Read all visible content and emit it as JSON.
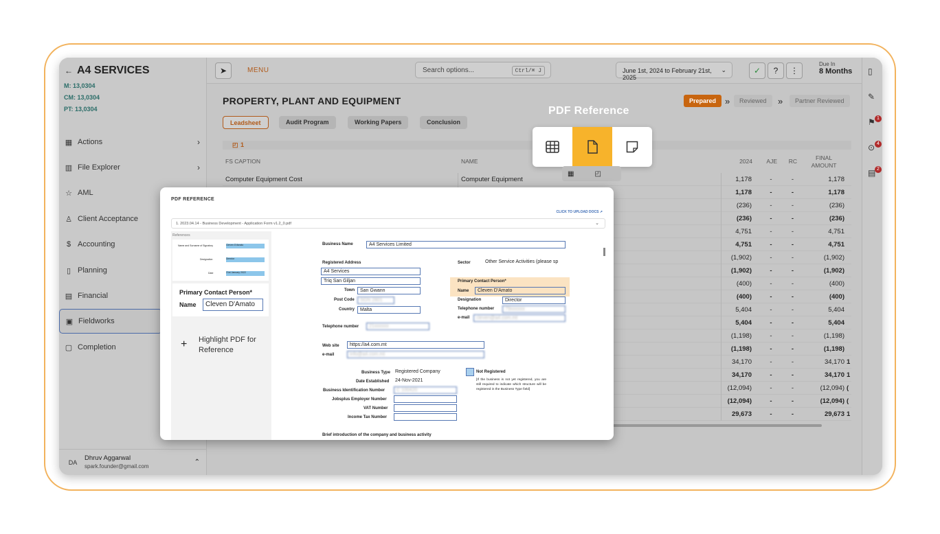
{
  "sidebar": {
    "company": "A4 SERVICES",
    "metrics": [
      "M: 13,0304",
      "CM: 13,0304",
      "PT: 13,0304"
    ],
    "items": [
      {
        "label": "Actions",
        "icon": "grid-icon",
        "chev": "›"
      },
      {
        "label": "File Explorer",
        "icon": "library-icon",
        "chev": "›"
      },
      {
        "label": "AML",
        "icon": "star-icon",
        "chev": ""
      },
      {
        "label": "Client Acceptance",
        "icon": "person-icon",
        "chev": ""
      },
      {
        "label": "Accounting",
        "icon": "dollar-icon",
        "chev": ""
      },
      {
        "label": "Planning",
        "icon": "map-icon",
        "chev": ""
      },
      {
        "label": "Financial",
        "icon": "chart-icon",
        "chev": ""
      },
      {
        "label": "Fieldworks",
        "icon": "fieldworks-icon",
        "chev": ""
      },
      {
        "label": "Completion",
        "icon": "document-icon",
        "chev": ""
      }
    ],
    "user": {
      "initials": "DA",
      "name": "Dhruv Aggarwal",
      "email": "spark.founder@gmail.com"
    }
  },
  "topbar": {
    "menu": "MENU",
    "search_placeholder": "Search options...",
    "shortcut": "Ctrl/⌘ J",
    "date_range": "June 1st, 2024 to February 21st, 2025",
    "due_label": "Due In",
    "due_value": "8 Months"
  },
  "page": {
    "title": "PROPERTY, PLANT AND EQUIPMENT",
    "statuses": [
      "Prepared",
      "Reviewed",
      "Partner Reviewed"
    ],
    "tabs": [
      "Leadsheet",
      "Audit Program",
      "Working Papers",
      "Conclusion"
    ],
    "note_count": "1",
    "columns": {
      "caption": "FS CAPTION",
      "name": "NAME",
      "y2024": "2024",
      "aje": "AJE",
      "rc": "RC",
      "final": "FINAL AMOUNT"
    },
    "rows": [
      {
        "caption": "Computer Equipment Cost",
        "name": "Computer Equipment",
        "v": "1,178",
        "aje": "-",
        "rc": "-",
        "f": "1,178",
        "b": false,
        "x": ""
      },
      {
        "caption": "",
        "name": "",
        "v": "1,178",
        "aje": "-",
        "rc": "-",
        "f": "1,178",
        "b": true,
        "x": ""
      },
      {
        "caption": "",
        "name": "",
        "v": "(236)",
        "aje": "-",
        "rc": "-",
        "f": "(236)",
        "b": false,
        "x": ""
      },
      {
        "caption": "",
        "name": "ction",
        "v": "(236)",
        "aje": "-",
        "rc": "-",
        "f": "(236)",
        "b": true,
        "x": ""
      },
      {
        "caption": "",
        "name": "",
        "v": "4,751",
        "aje": "-",
        "rc": "-",
        "f": "4,751",
        "b": false,
        "x": ""
      },
      {
        "caption": "",
        "name": "",
        "v": "4,751",
        "aje": "-",
        "rc": "-",
        "f": "4,751",
        "b": true,
        "x": ""
      },
      {
        "caption": "",
        "name": "",
        "v": "(1,902)",
        "aje": "-",
        "rc": "-",
        "f": "(1,902)",
        "b": false,
        "x": ""
      },
      {
        "caption": "",
        "name": "inery",
        "v": "(1,902)",
        "aje": "-",
        "rc": "-",
        "f": "(1,902)",
        "b": true,
        "x": ""
      },
      {
        "caption": "",
        "name": "",
        "v": "(400)",
        "aje": "-",
        "rc": "-",
        "f": "(400)",
        "b": false,
        "x": ""
      },
      {
        "caption": "",
        "name": "nt",
        "v": "(400)",
        "aje": "-",
        "rc": "-",
        "f": "(400)",
        "b": true,
        "x": ""
      },
      {
        "caption": "",
        "name": "",
        "v": "5,404",
        "aje": "-",
        "rc": "-",
        "f": "5,404",
        "b": false,
        "x": ""
      },
      {
        "caption": "",
        "name": "ings",
        "v": "5,404",
        "aje": "-",
        "rc": "-",
        "f": "5,404",
        "b": true,
        "x": ""
      },
      {
        "caption": "",
        "name": "",
        "v": "(1,198)",
        "aje": "-",
        "rc": "-",
        "f": "(1,198)",
        "b": false,
        "x": ""
      },
      {
        "caption": "",
        "name": "res, Fittings and Soft Furnishings",
        "v": "(1,198)",
        "aje": "-",
        "rc": "-",
        "f": "(1,198)",
        "b": true,
        "x": ""
      },
      {
        "caption": "",
        "name": "",
        "v": "34,170",
        "aje": "-",
        "rc": "-",
        "f": "34,170",
        "b": false,
        "x": "1"
      },
      {
        "caption": "",
        "name": "",
        "v": "34,170",
        "aje": "-",
        "rc": "-",
        "f": "34,170",
        "b": true,
        "x": "1"
      },
      {
        "caption": "",
        "name": "",
        "v": "(12,094)",
        "aje": "-",
        "rc": "-",
        "f": "(12,094)",
        "b": false,
        "x": "("
      },
      {
        "caption": "",
        "name": "",
        "v": "(12,094)",
        "aje": "-",
        "rc": "-",
        "f": "(12,094)",
        "b": true,
        "x": "("
      },
      {
        "caption": "",
        "name": "",
        "v": "29,673",
        "aje": "-",
        "rc": "-",
        "f": "29,673",
        "b": true,
        "x": "1"
      }
    ]
  },
  "pdf_popup": {
    "title": "PDF REFERENCE",
    "upload": "CLICK TO UPLOAD DOCS",
    "file": "1. 2023.04.14 - Business Development - Application Form v1.2_0.pdf",
    "references_label": "References",
    "ref_rows": [
      {
        "label": "Name and Surname of Signatory",
        "value": "Cleven D'Amato"
      },
      {
        "label": "Designation",
        "value": "Director"
      },
      {
        "label": "Date",
        "value": "21st January 2022"
      }
    ],
    "highlight_title": "Primary Contact Person*",
    "highlight_name_label": "Name",
    "highlight_name_value": "Cleven D'Amato",
    "add_label": "Highlight PDF for Reference",
    "doc": {
      "business_name_label": "Business Name",
      "business_name": "A4 Services Limited",
      "registered_address_label": "Registered Address",
      "address1": "A4 Services",
      "address2": "Triq San Giljan",
      "town_label": "Town",
      "town": "San Gwann",
      "post_label": "Post Code",
      "post": "SGN 2801",
      "country_label": "Country",
      "country": "Malta",
      "sector_label": "Sector",
      "sector": "Other Service Activities (please sp",
      "pcp_label": "Primary Contact Person*",
      "pcp_name_label": "Name",
      "pcp_name": "Cleven D'Amato",
      "designation_label": "Designation",
      "designation": "Director",
      "tel_label": "Telephone number",
      "tel": "79xxxxxx",
      "email_label": "e-mail",
      "email": "cleven@a4.com.mt",
      "tel2": "21xxxxxx",
      "web_label": "Web site",
      "web": "https://a4.com.mt",
      "email2": "info@a4.com.mt",
      "btype_label": "Business Type",
      "btype": "Registered Company",
      "est_label": "Date Established",
      "est": "24-Nov-2021",
      "bin_label": "Business Identification Number",
      "bin": "C 100420",
      "jobs_label": "Jobsplus Employer Number",
      "vat_label": "VAT Number",
      "tax_label": "Income Tax Number",
      "not_reg_label": "Not Registered",
      "not_reg_note": "[If the business is not yet registered, you are still required to indicate which structure will be registered in the Business Type field]",
      "brief_label": "Brief introduction of the company and business activity"
    }
  },
  "pdf_reference": {
    "label": "PDF Reference",
    "buttons": [
      "table-icon",
      "document-icon",
      "note-icon"
    ],
    "selected": "document-icon"
  },
  "colors": {
    "accent": "#f7b32b",
    "status_prepared": "#c8650f",
    "border": "#f2b25c"
  }
}
